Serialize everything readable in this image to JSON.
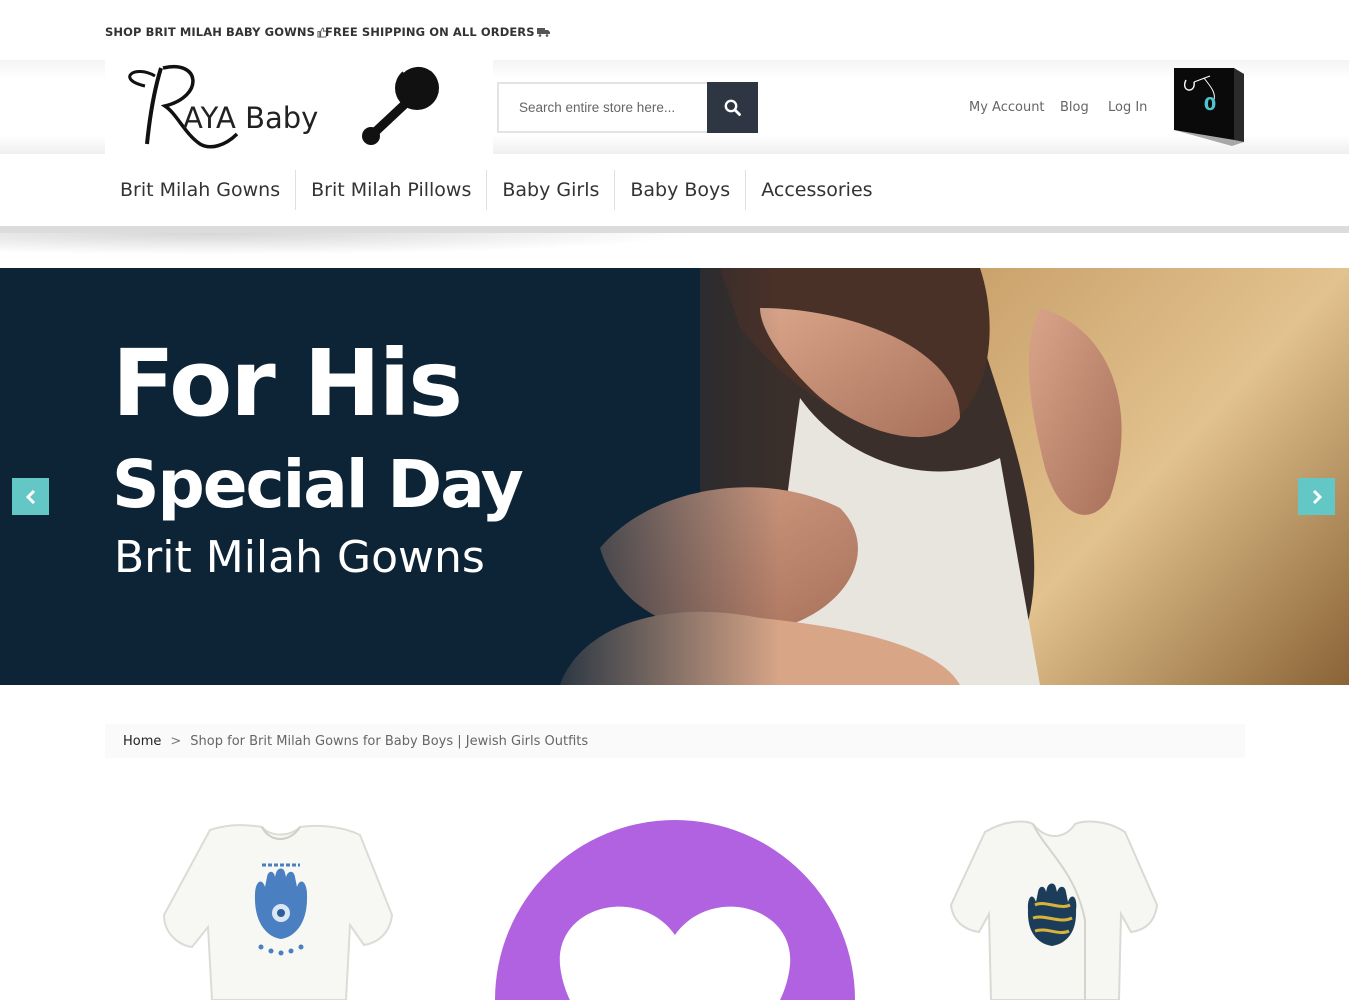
{
  "promo": {
    "shop_text": "SHOP BRIT MILAH BABY GOWNS",
    "shop_icon": "thumbs-up-icon",
    "shipping_text": "FREE SHIPPING ON ALL ORDERS",
    "shipping_icon": "truck-icon"
  },
  "logo": {
    "initial": "R",
    "text": "AYA Baby",
    "icon": "rattle-icon"
  },
  "search": {
    "placeholder": "Search entire store here...",
    "value": "",
    "button_icon": "search-icon"
  },
  "header_links": {
    "account": "My Account",
    "blog": "Blog",
    "login": "Log In"
  },
  "cart": {
    "count": "0",
    "icon": "shopping-bag-icon"
  },
  "nav": {
    "items": [
      {
        "label": "Brit Milah Gowns"
      },
      {
        "label": "Brit Milah Pillows"
      },
      {
        "label": "Baby Girls"
      },
      {
        "label": "Baby Boys"
      },
      {
        "label": "Accessories"
      }
    ]
  },
  "hero": {
    "line1": "For His",
    "line2": "Special Day",
    "line3": "Brit Milah Gowns",
    "prev_icon": "chevron-left-icon",
    "next_icon": "chevron-right-icon"
  },
  "breadcrumb": {
    "home": "Home",
    "separator": ">",
    "current": "Shop for Brit Milah Gowns for Baby Boys | Jewish Girls Outfits"
  },
  "products": [
    {
      "image": "white-onesie-blue-hamsa"
    },
    {
      "image": "purple-heart-placeholder"
    },
    {
      "image": "white-kimono-gold-hamsa"
    }
  ],
  "colors": {
    "search_button": "#2d3642",
    "carousel_arrow": "#63c7c6",
    "hero_background": "#0d2437",
    "cart_count": "#4fc3cf",
    "placeholder_purple": "#b062e0"
  }
}
